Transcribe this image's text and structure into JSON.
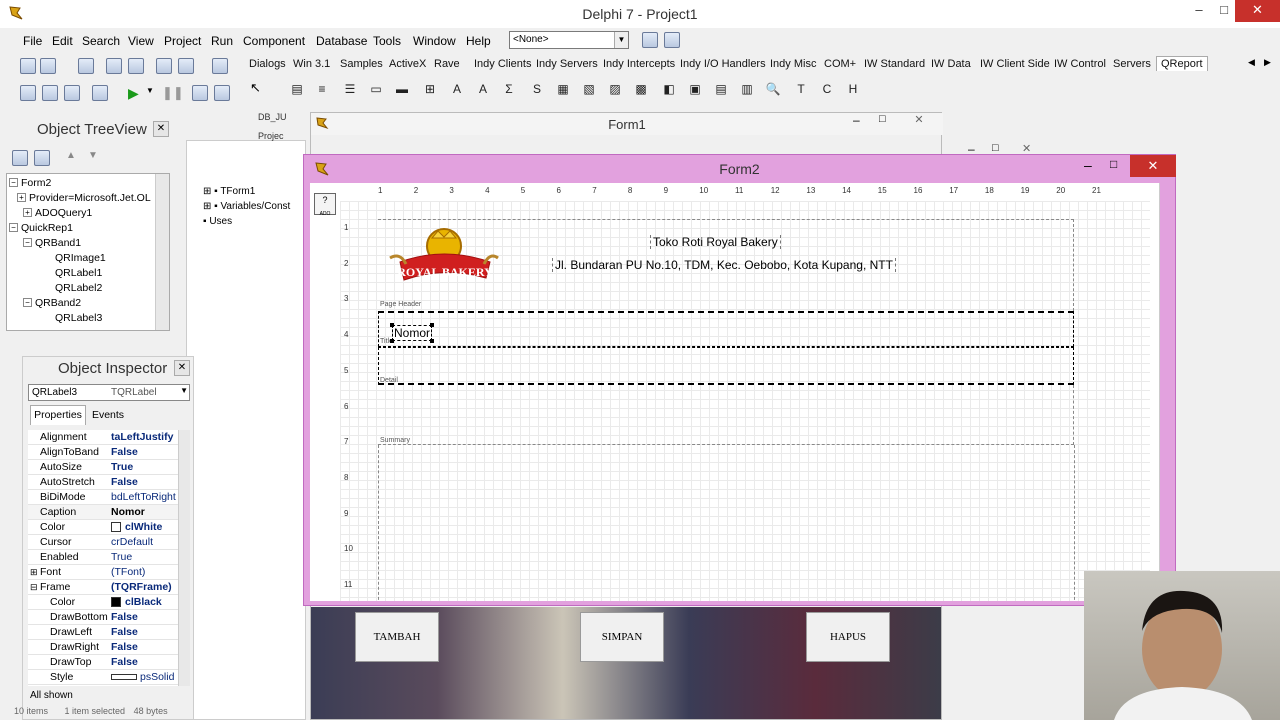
{
  "app": {
    "title": "Delphi 7 - Project1",
    "menu": [
      "File",
      "Edit",
      "Search",
      "View",
      "Project",
      "Run",
      "Component",
      "Database",
      "Tools",
      "Window",
      "Help"
    ],
    "combo_value": "<None>",
    "palette_tabs": [
      "Dialogs",
      "Win 3.1",
      "Samples",
      "ActiveX",
      "Rave",
      "Indy Clients",
      "Indy Servers",
      "Indy Intercepts",
      "Indy I/O Handlers",
      "Indy Misc",
      "COM+",
      "IW Standard",
      "IW Data",
      "IW Client Side",
      "IW Control",
      "Servers",
      "QReport"
    ],
    "active_palette_tab": "QReport"
  },
  "tree_view": {
    "title": "Object TreeView",
    "items": [
      {
        "label": "Form2",
        "level": 0
      },
      {
        "label": "Provider=Microsoft.Jet.OL",
        "level": 1
      },
      {
        "label": "ADOQuery1",
        "level": 1
      },
      {
        "label": "QuickRep1",
        "level": 0
      },
      {
        "label": "QRBand1",
        "level": 1
      },
      {
        "label": "QRImage1",
        "level": 2
      },
      {
        "label": "QRLabel1",
        "level": 2
      },
      {
        "label": "QRLabel2",
        "level": 2
      },
      {
        "label": "QRBand2",
        "level": 1
      },
      {
        "label": "QRLabel3",
        "level": 2
      }
    ]
  },
  "code_explorer": {
    "items": [
      "TForm1",
      "Variables/Const",
      "Uses"
    ],
    "file_items": [
      "DB_JU",
      "Projec"
    ]
  },
  "inspector": {
    "title": "Object Inspector",
    "selected": "QRLabel3",
    "selected_type": "TQRLabel",
    "tabs": [
      "Properties",
      "Events"
    ],
    "status": "All shown",
    "properties": [
      {
        "name": "Alignment",
        "value": "taLeftJustify",
        "bold": true
      },
      {
        "name": "AlignToBand",
        "value": "False",
        "bold": true
      },
      {
        "name": "AutoSize",
        "value": "True",
        "bold": true
      },
      {
        "name": "AutoStretch",
        "value": "False",
        "bold": true
      },
      {
        "name": "BiDiMode",
        "value": "bdLeftToRight",
        "bold": false
      },
      {
        "name": "Caption",
        "value": "Nomor",
        "bold": true
      },
      {
        "name": "Color",
        "value": "clWhite",
        "bold": true
      },
      {
        "name": "Cursor",
        "value": "crDefault",
        "bold": false
      },
      {
        "name": "Enabled",
        "value": "True",
        "bold": false
      },
      {
        "name": "Font",
        "value": "(TFont)",
        "bold": false
      },
      {
        "name": "Frame",
        "value": "(TQRFrame)",
        "bold": true
      },
      {
        "name": "Color",
        "value": "clBlack",
        "bold": true
      },
      {
        "name": "DrawBottom",
        "value": "False",
        "bold": true
      },
      {
        "name": "DrawLeft",
        "value": "False",
        "bold": true
      },
      {
        "name": "DrawRight",
        "value": "False",
        "bold": true
      },
      {
        "name": "DrawTop",
        "value": "False",
        "bold": true
      },
      {
        "name": "Style",
        "value": "psSolid",
        "bold": false
      }
    ]
  },
  "status_bar": {
    "items": "10 items",
    "selected": "1 item selected",
    "size": "48 bytes"
  },
  "form1": {
    "title": "Form1"
  },
  "form2": {
    "title": "Form2",
    "ruler_top": [
      "1",
      "2",
      "3",
      "4",
      "5",
      "6",
      "7",
      "8",
      "9",
      "10",
      "11",
      "12",
      "13",
      "14",
      "15",
      "16",
      "17",
      "18",
      "19",
      "20",
      "21"
    ],
    "ruler_left": [
      "1",
      "2",
      "3",
      "4",
      "5",
      "6",
      "7",
      "8",
      "9",
      "10",
      "11"
    ],
    "logo_text": "ROYAL BAKERY",
    "title_label": "Toko Roti Royal Bakery",
    "address_label": "Jl. Bundaran PU No.10, TDM, Kec. Oebobo, Kota Kupang, NTT",
    "band_page_header": "Page Header",
    "band_title": "Title",
    "band_detail": "Detail",
    "band_summary": "Summary",
    "nomor_label": "Nomor"
  },
  "buttons": {
    "tambah": "TAMBAH",
    "simpan": "SIMPAN",
    "hapus": "HAPUS"
  }
}
